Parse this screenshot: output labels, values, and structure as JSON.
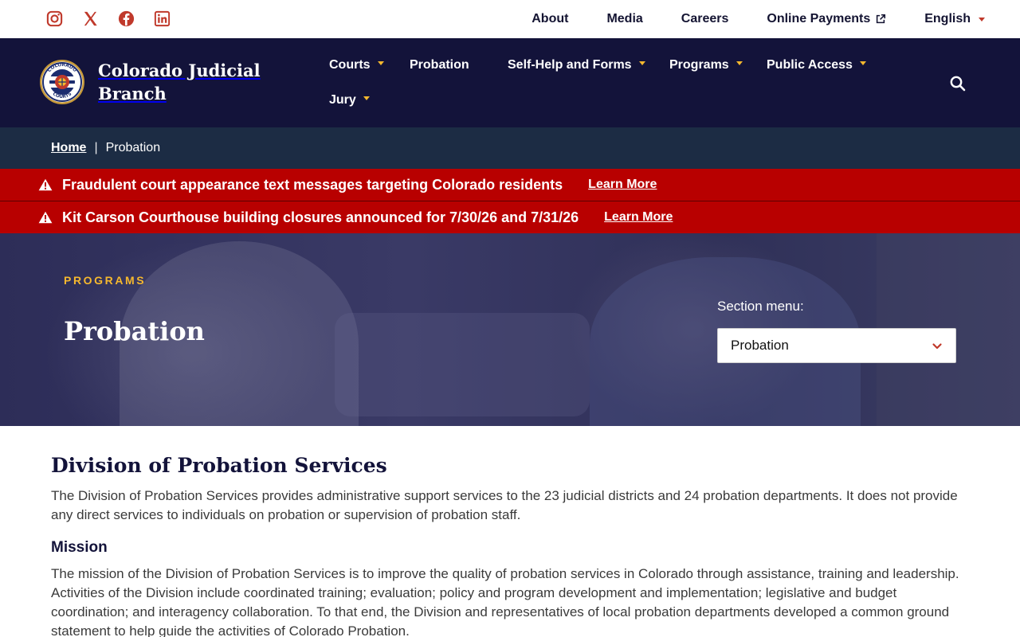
{
  "colors": {
    "utility_bg": "#ffffff",
    "header_bg": "#13133a",
    "breadcrumb_bg": "#1c2c44",
    "alert_bg": "#b80000",
    "accent_gold": "#f5b82e",
    "social_red": "#c0392b"
  },
  "social_links": [
    {
      "icon": "instagram-icon"
    },
    {
      "icon": "x-twitter-icon"
    },
    {
      "icon": "facebook-icon"
    },
    {
      "icon": "linkedin-icon"
    }
  ],
  "utility_nav": {
    "about": "About",
    "media": "Media",
    "careers": "Careers",
    "online_payments": "Online Payments",
    "language": "English"
  },
  "header": {
    "site_name": "Colorado Judicial Branch",
    "seal_lettering": [
      "COLORADO",
      "COURTS"
    ]
  },
  "primary_nav": [
    {
      "label": "Courts",
      "has_dropdown": true
    },
    {
      "label": "Probation",
      "has_dropdown": false
    },
    {
      "label": "Self-Help and Forms",
      "has_dropdown": true
    },
    {
      "label": "Programs",
      "has_dropdown": true
    },
    {
      "label": "Public Access",
      "has_dropdown": true
    },
    {
      "label": "Jury",
      "has_dropdown": true
    }
  ],
  "breadcrumb": {
    "home": "Home",
    "separator": "|",
    "current": "Probation"
  },
  "alerts": [
    {
      "message": "Fraudulent court appearance text messages targeting Colorado residents",
      "link": "Learn More"
    },
    {
      "message": "Kit Carson Courthouse building closures announced for 7/30/26 and 7/31/26",
      "link": "Learn More"
    }
  ],
  "hero": {
    "eyebrow": "PROGRAMS",
    "title": "Probation",
    "section_menu_label": "Section menu:",
    "section_menu_value": "Probation"
  },
  "content": {
    "heading": "Division of Probation Services",
    "intro": "The Division of Probation Services provides administrative support services to the 23 judicial districts and 24 probation departments. It does not provide any direct services to individuals on probation or supervision of probation staff.",
    "mission_heading": "Mission",
    "mission_text": "The mission of the Division of Probation Services is to improve the quality of probation services in Colorado through assistance, training and leadership. Activities of the Division include coordinated training; evaluation; policy and program development and implementation; legislative and budget coordination; and interagency collaboration. To that end, the Division and representatives of local probation departments developed a common ground statement to help guide the activities of Colorado Probation."
  }
}
